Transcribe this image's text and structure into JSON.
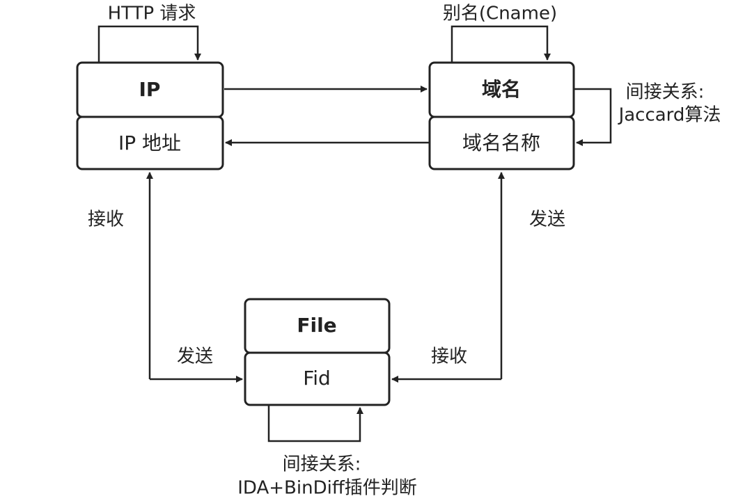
{
  "entities": {
    "ip": {
      "title": "IP",
      "field": "IP 地址"
    },
    "domain": {
      "title": "域名",
      "field": "域名名称"
    },
    "file": {
      "title": "File",
      "field": "Fid"
    }
  },
  "relations": {
    "ip_self": "HTTP 请求",
    "domain_self": "别名(Cname)",
    "domain_indirect_line1": "间接关系:",
    "domain_indirect_line2": "Jaccard算法",
    "ip_file_receive": "接收",
    "ip_file_send": "发送",
    "domain_file_send": "发送",
    "domain_file_receive": "接收",
    "file_indirect_line1": "间接关系:",
    "file_indirect_line2": "IDA+BinDiff插件判断"
  },
  "colors": {
    "stroke": "#222222",
    "background": "#ffffff"
  }
}
